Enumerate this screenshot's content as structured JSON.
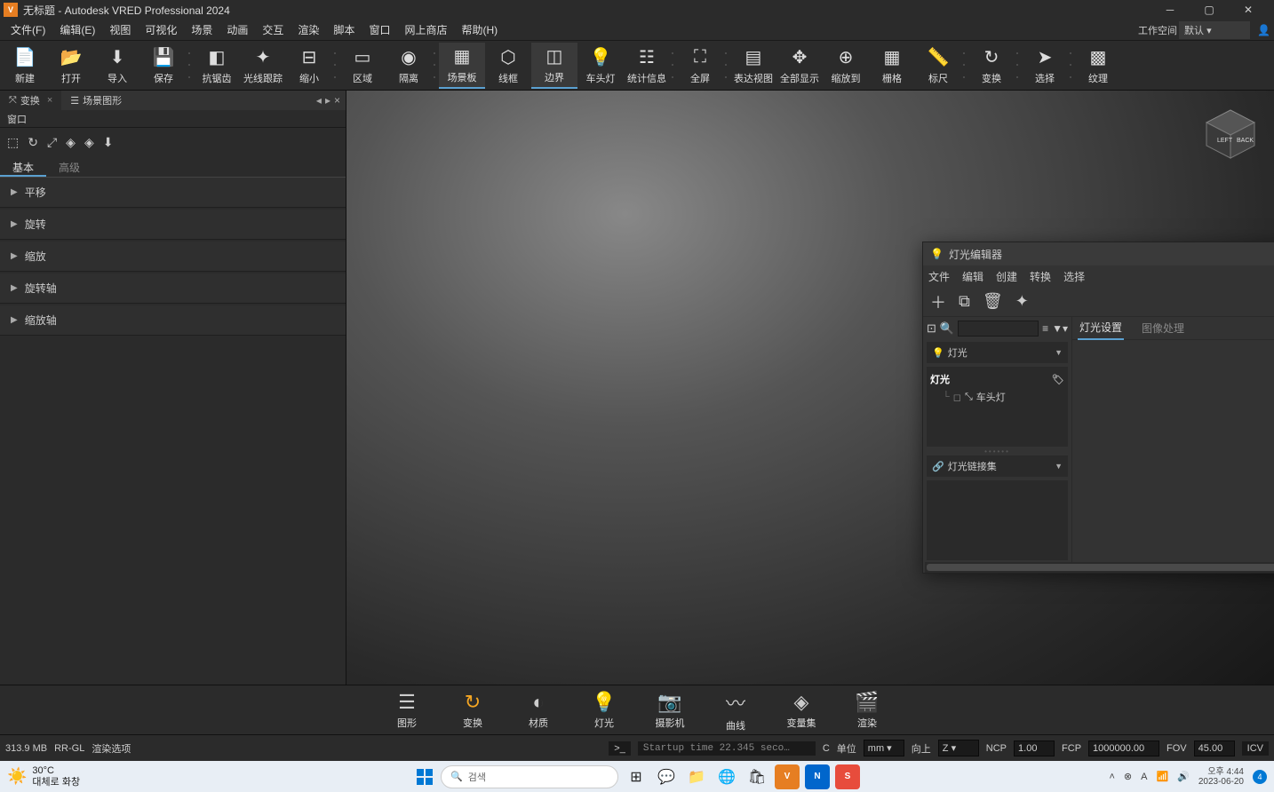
{
  "titlebar": {
    "title": "无标题 - Autodesk VRED Professional 2024",
    "app_icon": "V"
  },
  "menubar": {
    "items": [
      "文件(F)",
      "编辑(E)",
      "视图",
      "可视化",
      "场景",
      "动画",
      "交互",
      "渲染",
      "脚本",
      "窗口",
      "网上商店",
      "帮助(H)"
    ],
    "workspace_label": "工作空间",
    "workspace_value": "默认"
  },
  "toolbar": {
    "buttons": [
      {
        "label": "新建",
        "icon": "file"
      },
      {
        "label": "打开",
        "icon": "folder"
      },
      {
        "label": "导入",
        "icon": "import"
      },
      {
        "label": "保存",
        "icon": "save"
      },
      {
        "label": "抗锯齿",
        "icon": "aa"
      },
      {
        "label": "光线跟踪",
        "icon": "ray"
      },
      {
        "label": "缩小",
        "icon": "downscale"
      },
      {
        "label": "区域",
        "icon": "region"
      },
      {
        "label": "隔离",
        "icon": "isolate"
      },
      {
        "label": "场景板",
        "icon": "scene",
        "active": true
      },
      {
        "label": "线框",
        "icon": "wire"
      },
      {
        "label": "边界",
        "icon": "bbox",
        "active": true
      },
      {
        "label": "车头灯",
        "icon": "headlight"
      },
      {
        "label": "统计信息",
        "icon": "stats"
      },
      {
        "label": "全屏",
        "icon": "fullscreen"
      },
      {
        "label": "表达视图",
        "icon": "present"
      },
      {
        "label": "全部显示",
        "icon": "showall"
      },
      {
        "label": "缩放到",
        "icon": "zoomto"
      },
      {
        "label": "栅格",
        "icon": "grid"
      },
      {
        "label": "标尺",
        "icon": "ruler"
      },
      {
        "label": "变换",
        "icon": "transform"
      },
      {
        "label": "选择",
        "icon": "select"
      },
      {
        "label": "纹理",
        "icon": "texture"
      }
    ]
  },
  "left_panel": {
    "tabs": [
      {
        "label": "变换",
        "icon": "transform",
        "active": true
      },
      {
        "label": "场景图形",
        "icon": "scenegraph"
      }
    ],
    "subheader": "窗口",
    "subtabs": [
      "基本",
      "高级"
    ],
    "accordion": [
      "平移",
      "旋转",
      "缩放",
      "旋转轴",
      "缩放轴"
    ]
  },
  "viewcube": {
    "left": "LEFT",
    "back": "BACK"
  },
  "light_editor": {
    "title": "灯光编辑器",
    "menu": [
      "文件",
      "编辑",
      "创建",
      "转换",
      "选择"
    ],
    "search_placeholder": "",
    "dropdown1": "灯光",
    "tree_root": "灯光",
    "tree_child": "车头灯",
    "dropdown2": "灯光链接集",
    "right_tabs": [
      "灯光设置",
      "图像处理"
    ]
  },
  "bottom_bar": {
    "buttons": [
      {
        "label": "图形",
        "icon": "graph"
      },
      {
        "label": "变换",
        "icon": "transform",
        "active": true
      },
      {
        "label": "材质",
        "icon": "material"
      },
      {
        "label": "灯光",
        "icon": "light",
        "active": true
      },
      {
        "label": "摄影机",
        "icon": "camera"
      },
      {
        "label": "曲线",
        "icon": "curve"
      },
      {
        "label": "变量集",
        "icon": "varset"
      },
      {
        "label": "渲染",
        "icon": "render"
      }
    ]
  },
  "statusbar": {
    "memory": "313.9 MB",
    "renderer": "RR-GL",
    "render_opts": "渲染选项",
    "console": "Startup time 22.345 seco…",
    "c_label": "C",
    "unit_label": "单位",
    "unit_value": "mm",
    "up_label": "向上",
    "up_value": "Z",
    "ncp_label": "NCP",
    "ncp_value": "1.00",
    "fcp_label": "FCP",
    "fcp_value": "1000000.00",
    "fov_label": "FOV",
    "fov_value": "45.00",
    "icv_label": "ICV"
  },
  "taskbar": {
    "temp": "30°C",
    "weather_desc": "대체로 화창",
    "search_placeholder": "검색",
    "time": "오후 4:44",
    "date": "2023-06-20",
    "notif_count": "4"
  }
}
